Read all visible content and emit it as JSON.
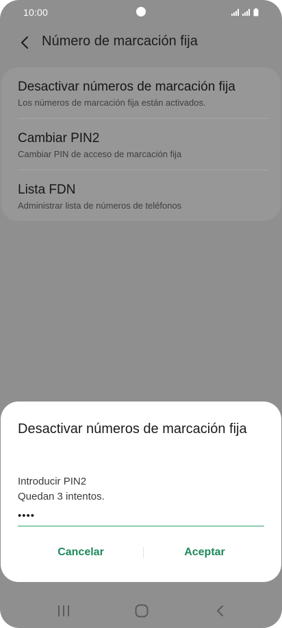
{
  "status_bar": {
    "time": "10:00",
    "icons": [
      "signal-icon",
      "signal-icon",
      "battery-icon"
    ]
  },
  "header": {
    "title": "Número de marcación fija",
    "back_icon": "chevron-left-icon"
  },
  "settings": {
    "items": [
      {
        "title": "Desactivar números de marcación fija",
        "subtitle": "Los números de marcación fija están activados."
      },
      {
        "title": "Cambiar PIN2",
        "subtitle": "Cambiar PIN de acceso de marcación fija"
      },
      {
        "title": "Lista FDN",
        "subtitle": "Administrar lista de números de teléfonos"
      }
    ]
  },
  "dialog": {
    "title": "Desactivar números de marcación fija",
    "label": "Introducir PIN2",
    "attempts": "Quedan 3 intentos.",
    "pin_value": "••••",
    "cancel_label": "Cancelar",
    "accept_label": "Aceptar",
    "accent_color": "#1e8a5b"
  },
  "nav_bar": {
    "icons": [
      "recent-apps-icon",
      "home-icon",
      "back-icon"
    ]
  }
}
